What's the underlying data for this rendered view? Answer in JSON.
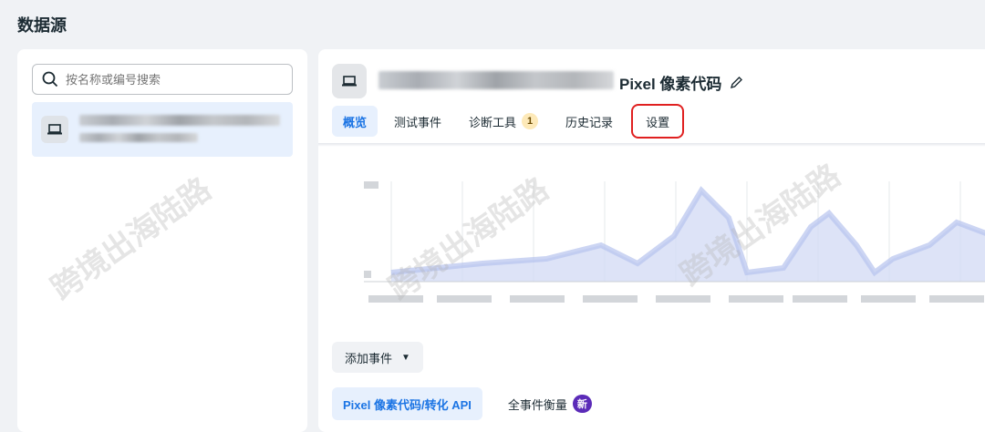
{
  "page_title": "数据源",
  "search": {
    "placeholder": "按名称或编号搜索"
  },
  "header": {
    "title_suffix": "Pixel 像素代码"
  },
  "tabs": [
    {
      "label": "概览",
      "active": true
    },
    {
      "label": "测试事件"
    },
    {
      "label": "诊断工具",
      "badge": "1"
    },
    {
      "label": "历史记录"
    },
    {
      "label": "设置",
      "highlighted": true
    }
  ],
  "add_event": {
    "label": "添加事件"
  },
  "bottom_tabs": [
    {
      "label": "Pixel 像素代码/转化 API",
      "active": true
    },
    {
      "label": "全事件衡量",
      "badge": "新"
    }
  ],
  "colors": {
    "accent": "#1b74e4",
    "highlight": "#e02020",
    "new_badge": "#5b2bb8"
  },
  "watermark": "跨境出海陆路"
}
